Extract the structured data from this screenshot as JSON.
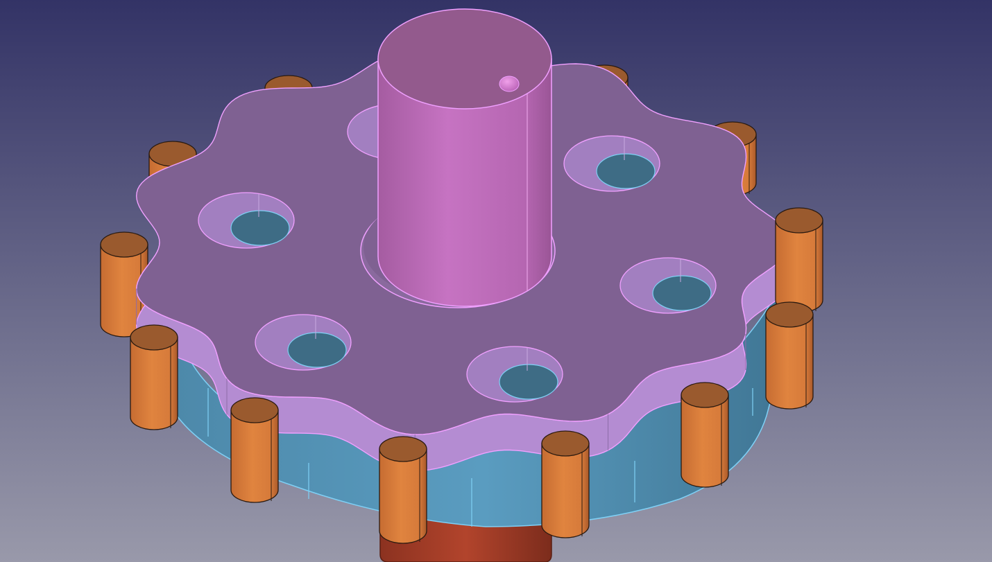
{
  "viewport": {
    "background_top": "#333366",
    "background_bottom": "#9999aa"
  },
  "model": {
    "colors": {
      "plate_top": "#7f6192",
      "plate_side": "#b48cd2",
      "plate_side_dark": "#8e6ba8",
      "plate_edge": "#f0a0ff",
      "hub_top": "#935a8d",
      "hub_side": "#c673c2",
      "hub_side_dark": "#9a5596",
      "lower_ring": "#5a9cc0",
      "lower_ring_dark": "#3f7593",
      "lower_edge": "#7fd0f5",
      "hole_floor": "#3e6c85",
      "hole_wall": "#a27fc0",
      "pin_top": "#9a5a2e",
      "pin_side": "#d67a3a",
      "pin_side_dark": "#a9592a",
      "base": "#b2442c",
      "base_dark": "#7c2c1c"
    },
    "counts": {
      "pins": 15,
      "holes": 7,
      "plate_lobes": 11
    }
  }
}
